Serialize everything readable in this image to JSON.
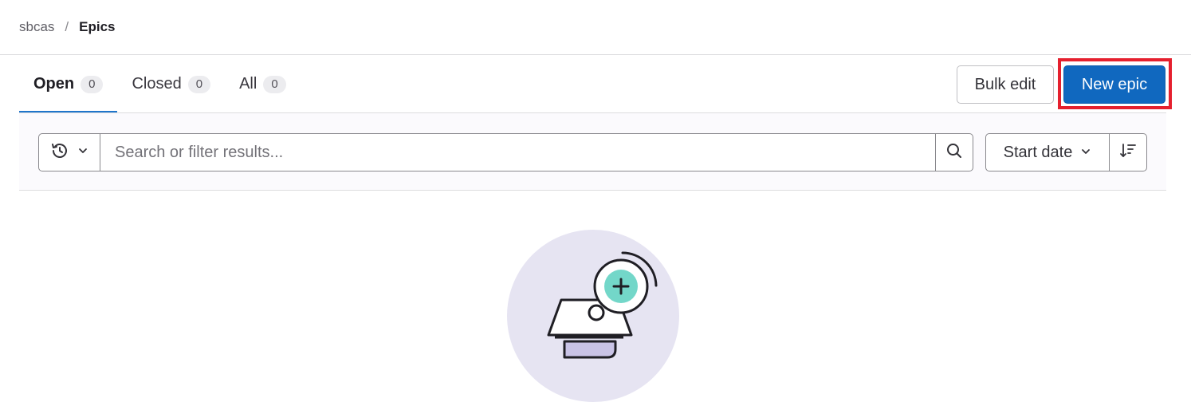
{
  "breadcrumb": {
    "parent": "sbcas",
    "separator": "/",
    "current": "Epics"
  },
  "tabs": [
    {
      "label": "Open",
      "count": "0",
      "active": true
    },
    {
      "label": "Closed",
      "count": "0",
      "active": false
    },
    {
      "label": "All",
      "count": "0",
      "active": false
    }
  ],
  "actions": {
    "bulk_edit_label": "Bulk edit",
    "new_epic_label": "New epic"
  },
  "filter": {
    "history_icon": "history-icon",
    "search_placeholder": "Search or filter results...",
    "search_value": "",
    "sort_label": "Start date",
    "sort_direction_icon": "sort-lowest-icon"
  },
  "colors": {
    "primary": "#1068bf",
    "active_tab": "#1f75cb",
    "highlight": "#e5202e",
    "empty_state_bg": "#e6e4f2",
    "accent_teal": "#73d7c9"
  }
}
